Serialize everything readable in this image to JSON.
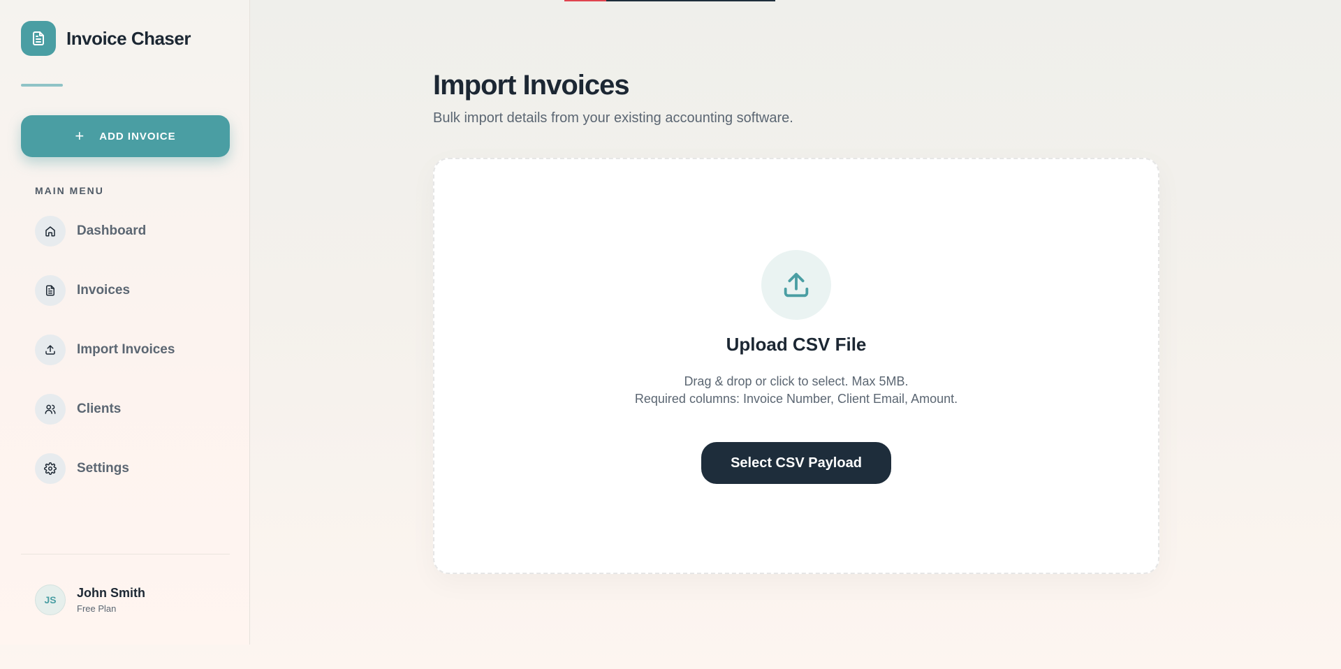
{
  "app": {
    "title": "Invoice Chaser"
  },
  "sidebar": {
    "add_button": {
      "icon": "plus-icon",
      "label": "ADD INVOICE"
    },
    "menu_heading": "MAIN MENU",
    "items": [
      {
        "label": "Dashboard",
        "icon": "home-icon"
      },
      {
        "label": "Invoices",
        "icon": "document-icon"
      },
      {
        "label": "Import Invoices",
        "icon": "upload-icon"
      },
      {
        "label": "Clients",
        "icon": "users-icon"
      },
      {
        "label": "Settings",
        "icon": "gear-icon"
      }
    ],
    "user": {
      "initials": "JS",
      "name": "John Smith",
      "plan": "Free Plan"
    }
  },
  "main": {
    "title": "Import Invoices",
    "subtitle": "Bulk import details from your existing accounting software.",
    "dropzone": {
      "icon": "upload-icon",
      "title": "Upload CSV File",
      "description_line1": "Drag & drop or click to select. Max 5MB.",
      "description_line2": "Required columns: Invoice Number, Client Email, Amount.",
      "button_label": "Select CSV Payload"
    }
  },
  "colors": {
    "accent": "#4a9ea3",
    "dark": "#1e2d3b",
    "text_muted": "#5b6672",
    "top_indicator": "#e0444f"
  }
}
